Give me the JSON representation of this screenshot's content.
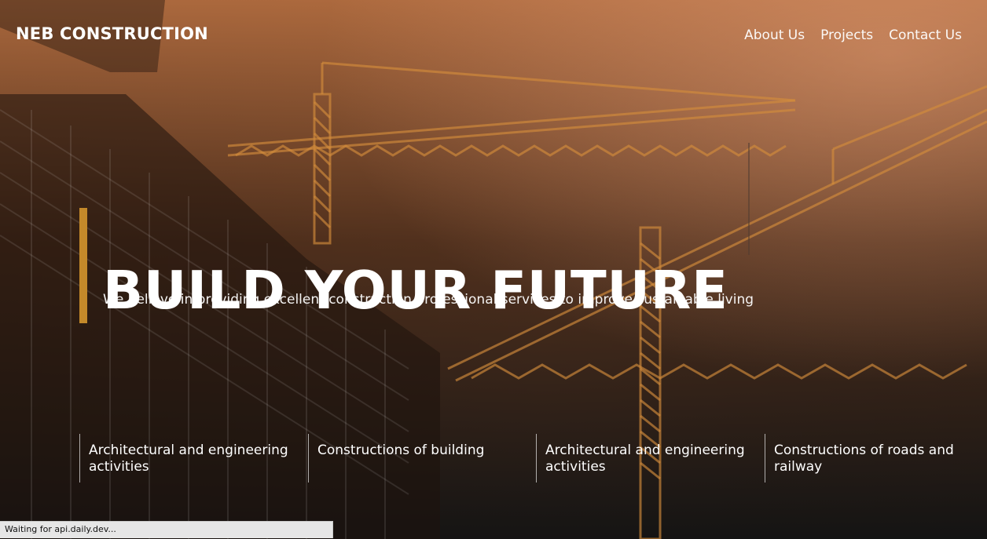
{
  "header": {
    "brand": "NEB CONSTRUCTION",
    "nav": [
      {
        "label": "About Us"
      },
      {
        "label": "Projects"
      },
      {
        "label": "Contact Us"
      }
    ]
  },
  "hero": {
    "title": "BUILD YOUR FUTURE",
    "subtitle": "We believe in providing excellent construction professional services to improve sustainable living",
    "accent_color": "#c4892a"
  },
  "services": [
    {
      "label": "Architectural and engineering activities"
    },
    {
      "label": "Constructions of building"
    },
    {
      "label": "Architectural and engineering activities"
    },
    {
      "label": "Constructions of roads and railway"
    }
  ],
  "status_bar": {
    "text": "Waiting for api.daily.dev..."
  }
}
